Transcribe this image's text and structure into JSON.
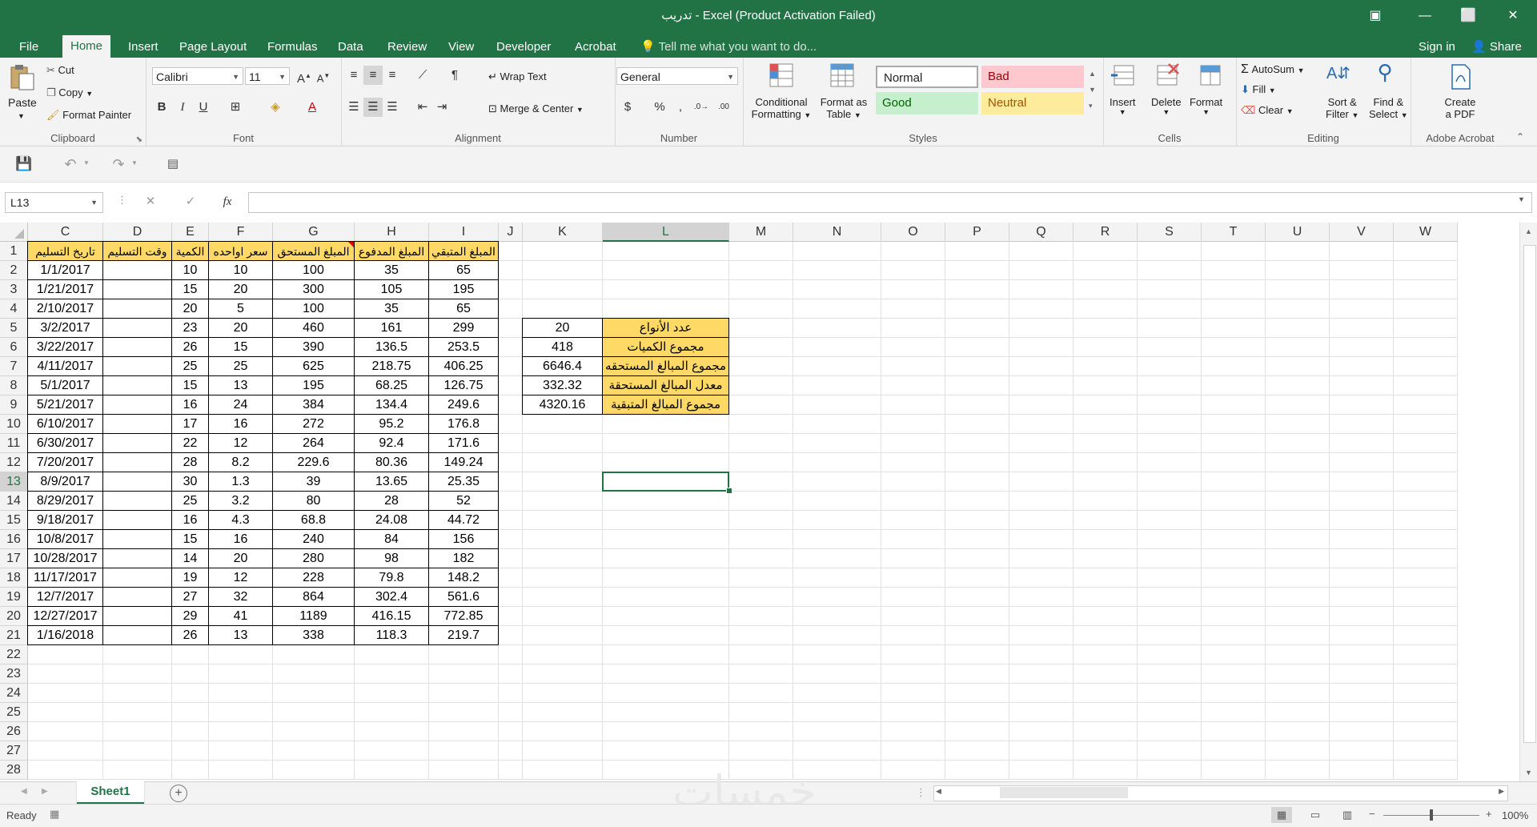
{
  "window": {
    "title": "تدريب - Excel (Product Activation Failed)",
    "restore_icon": "⬜",
    "minimize_icon": "—",
    "close_icon": "✕",
    "ribbon_display_icon": "▣"
  },
  "tabs": [
    "File",
    "Home",
    "Insert",
    "Page Layout",
    "Formulas",
    "Data",
    "Review",
    "View",
    "Developer",
    "Acrobat"
  ],
  "tell_me": "Tell me what you want to do...",
  "sign_in": "Sign in",
  "share": "Share",
  "ribbon": {
    "clipboard": {
      "label": "Clipboard",
      "paste": "Paste",
      "cut": "Cut",
      "copy": "Copy",
      "format_painter": "Format Painter"
    },
    "font": {
      "label": "Font",
      "font_name": "Calibri",
      "font_size": "11"
    },
    "alignment": {
      "label": "Alignment",
      "wrap_text": "Wrap Text",
      "merge_center": "Merge & Center"
    },
    "number": {
      "label": "Number",
      "format": "General"
    },
    "styles": {
      "label": "Styles",
      "conditional_formatting": [
        "Conditional",
        "Formatting"
      ],
      "format_as_table": [
        "Format as",
        "Table"
      ],
      "normal": "Normal",
      "bad": "Bad",
      "good": "Good",
      "neutral": "Neutral"
    },
    "cells": {
      "label": "Cells",
      "insert": "Insert",
      "delete": "Delete",
      "format": "Format"
    },
    "editing": {
      "label": "Editing",
      "autosum": "AutoSum",
      "fill": "Fill",
      "clear": "Clear",
      "sort_filter": [
        "Sort &",
        "Filter"
      ],
      "find_select": [
        "Find &",
        "Select"
      ]
    },
    "acrobat": {
      "label": "Adobe Acrobat",
      "create_pdf": [
        "Create",
        "a PDF"
      ]
    }
  },
  "formula_bar": {
    "name_box": "L13",
    "fx": "fx",
    "formula": ""
  },
  "columns": [
    "C",
    "D",
    "E",
    "F",
    "G",
    "H",
    "I",
    "J",
    "K",
    "L",
    "M",
    "N",
    "O",
    "P",
    "Q",
    "R",
    "S",
    "T",
    "U",
    "V",
    "W"
  ],
  "rows": [
    "1",
    "2",
    "3",
    "4",
    "5",
    "6",
    "7",
    "8",
    "9",
    "10",
    "11",
    "12",
    "13",
    "14",
    "15",
    "16",
    "17",
    "18",
    "19",
    "20",
    "21",
    "22",
    "23",
    "24",
    "25",
    "26",
    "27",
    "28"
  ],
  "table": {
    "headers": [
      "تاريخ التسليم",
      "وقت التسليم",
      "الكمية",
      "سعر اواحده",
      "المبلغ المستحق",
      "المبلغ المدفوع",
      "المبلغ المتبقي"
    ],
    "rows": [
      [
        "1/1/2017",
        "",
        "10",
        "10",
        "100",
        "35",
        "65"
      ],
      [
        "1/21/2017",
        "",
        "15",
        "20",
        "300",
        "105",
        "195"
      ],
      [
        "2/10/2017",
        "",
        "20",
        "5",
        "100",
        "35",
        "65"
      ],
      [
        "3/2/2017",
        "",
        "23",
        "20",
        "460",
        "161",
        "299"
      ],
      [
        "3/22/2017",
        "",
        "26",
        "15",
        "390",
        "136.5",
        "253.5"
      ],
      [
        "4/11/2017",
        "",
        "25",
        "25",
        "625",
        "218.75",
        "406.25"
      ],
      [
        "5/1/2017",
        "",
        "15",
        "13",
        "195",
        "68.25",
        "126.75"
      ],
      [
        "5/21/2017",
        "",
        "16",
        "24",
        "384",
        "134.4",
        "249.6"
      ],
      [
        "6/10/2017",
        "",
        "17",
        "16",
        "272",
        "95.2",
        "176.8"
      ],
      [
        "6/30/2017",
        "",
        "22",
        "12",
        "264",
        "92.4",
        "171.6"
      ],
      [
        "7/20/2017",
        "",
        "28",
        "8.2",
        "229.6",
        "80.36",
        "149.24"
      ],
      [
        "8/9/2017",
        "",
        "30",
        "1.3",
        "39",
        "13.65",
        "25.35"
      ],
      [
        "8/29/2017",
        "",
        "25",
        "3.2",
        "80",
        "28",
        "52"
      ],
      [
        "9/18/2017",
        "",
        "16",
        "4.3",
        "68.8",
        "24.08",
        "44.72"
      ],
      [
        "10/8/2017",
        "",
        "15",
        "16",
        "240",
        "84",
        "156"
      ],
      [
        "10/28/2017",
        "",
        "14",
        "20",
        "280",
        "98",
        "182"
      ],
      [
        "11/17/2017",
        "",
        "19",
        "12",
        "228",
        "79.8",
        "148.2"
      ],
      [
        "12/7/2017",
        "",
        "27",
        "32",
        "864",
        "302.4",
        "561.6"
      ],
      [
        "12/27/2017",
        "",
        "29",
        "41",
        "1189",
        "416.15",
        "772.85"
      ],
      [
        "1/16/2018",
        "",
        "26",
        "13",
        "338",
        "118.3",
        "219.7"
      ]
    ]
  },
  "summary": [
    {
      "label": "عدد الأنواع",
      "value": "20"
    },
    {
      "label": "مجموع الكميات",
      "value": "418"
    },
    {
      "label": "مجموع المبالغ المستحقه",
      "value": "6646.4"
    },
    {
      "label": "معدل المبالغ المستحقة",
      "value": "332.32"
    },
    {
      "label": "مجموع المبالغ المتبقية",
      "value": "4320.16"
    }
  ],
  "sheet_tab": "Sheet1",
  "status": {
    "ready": "Ready",
    "zoom": "100%"
  },
  "watermark": "خمسات",
  "colors": {
    "excel_green": "#217346",
    "header_fill": "#ffd966",
    "bad": "#ffc7ce",
    "good": "#c6efce",
    "neutral": "#ffeb9c"
  }
}
